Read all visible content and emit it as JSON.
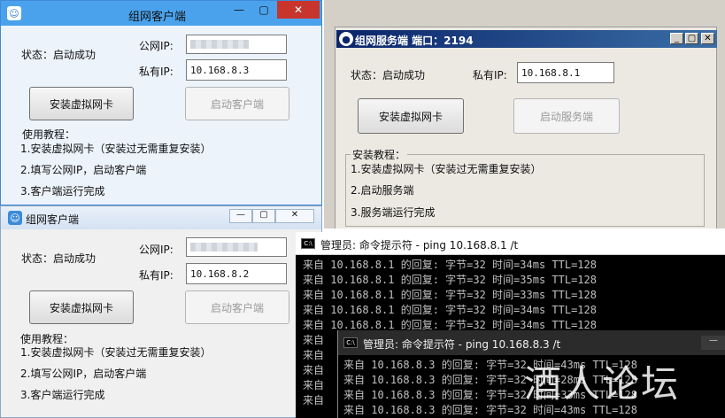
{
  "client_top": {
    "title": "组网客户端",
    "status": "状态：启动成功",
    "public_ip_label": "公网IP:",
    "public_ip_value": "",
    "private_ip_label": "私有IP:",
    "private_ip_value": "10.168.8.3",
    "install_button": "安装虚拟网卡",
    "start_button": "启动客户端",
    "tutorial_title": "使用教程：",
    "steps": [
      "1.安装虚拟网卡（安装过无需重复安装）",
      "2.填写公网IP，启动客户端",
      "3.客户端运行完成"
    ],
    "controls": {
      "minimize": "—",
      "restore": "▢",
      "close": "✕"
    }
  },
  "server": {
    "title": "组网服务端  端口：2194",
    "status": "状态：启动成功",
    "private_ip_label": "私有IP:",
    "private_ip_value": "10.168.8.1",
    "install_button": "安装虚拟网卡",
    "start_button": "启动服务端",
    "tutorial_title": "安装教程：",
    "steps": [
      "1.安装虚拟网卡（安装过无需重复安装）",
      "2.启动服务端",
      "3.服务端运行完成"
    ]
  },
  "client_bottom": {
    "title": "组网客户端",
    "status": "状态：启动成功",
    "public_ip_label": "公网IP:",
    "public_ip_value": "",
    "private_ip_label": "私有IP:",
    "private_ip_value": "10.168.8.2",
    "install_button": "安装虚拟网卡",
    "start_button": "启动客户端",
    "tutorial_title": "使用教程：",
    "steps": [
      "1.安装虚拟网卡（安装过无需重复安装）",
      "2.填写公网IP，启动客户端",
      "3.客户端运行完成"
    ]
  },
  "console_1": {
    "title": "管理员: 命令提示符 - ping  10.168.8.1 /t",
    "icon_text": "C:\\",
    "lines": [
      "来自 10.168.8.1 的回复: 字节=32 时间=34ms TTL=128",
      "来自 10.168.8.1 的回复: 字节=32 时间=35ms TTL=128",
      "来自 10.168.8.1 的回复: 字节=32 时间=33ms TTL=128",
      "来自 10.168.8.1 的回复: 字节=32 时间=34ms TTL=128",
      "来自 10.168.8.1 的回复: 字节=32 时间=34ms TTL=128",
      "来自",
      "来自",
      "来自",
      "来自",
      "来自"
    ]
  },
  "console_2": {
    "title": "管理员: 命令提示符 - ping  10.168.8.3 /t",
    "icon_text": "C:\\",
    "minimize": "—",
    "lines": [
      "来自 10.168.8.3 的回复: 字节=32 时间=43ms TTL=128",
      "来自 10.168.8.3 的回复: 字节=32 时间=28ms TTL=128",
      "来自 10.168.8.3 的回复: 字节=32 时间=33ms TTL=128",
      "来自 10.168.8.3 的回复: 字节=32 时间=43ms TTL=128"
    ]
  },
  "watermark": "酒人论坛"
}
